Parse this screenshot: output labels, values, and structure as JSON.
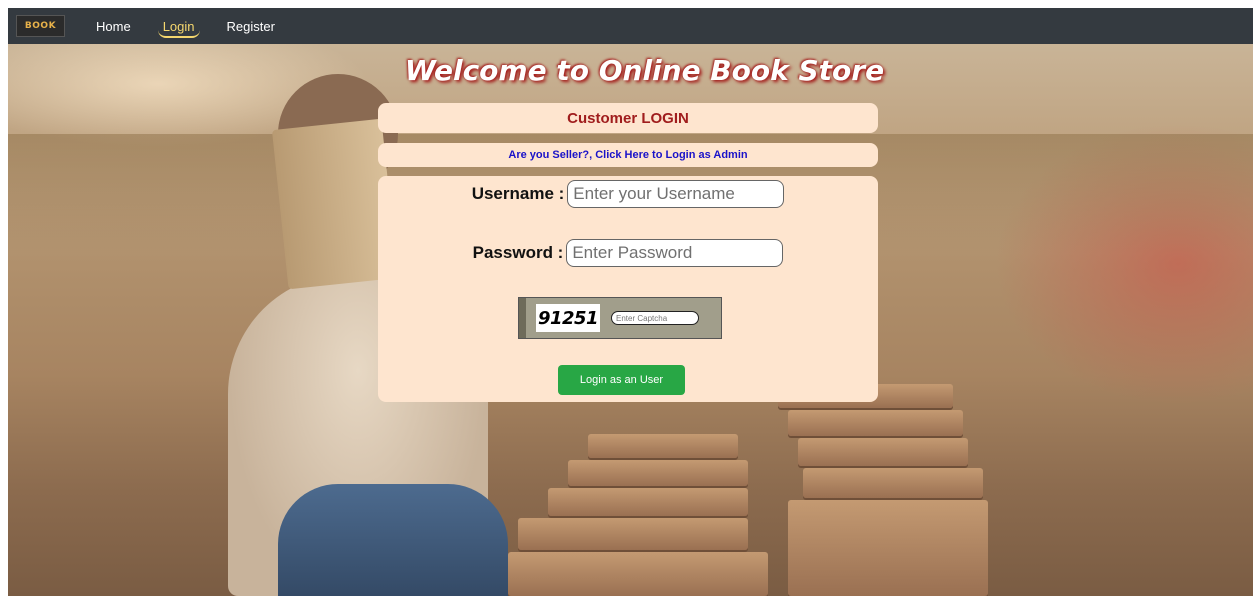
{
  "nav": {
    "logo_text": "BOOK",
    "items": [
      {
        "label": "Home"
      },
      {
        "label": "Login"
      },
      {
        "label": "Register"
      }
    ],
    "active": "Login"
  },
  "page": {
    "heading": "Welcome to Online Book Store",
    "subtitle": "Customer LOGIN",
    "seller_link": "Are you Seller?, Click Here to Login as Admin"
  },
  "form": {
    "username_label": "Username :",
    "username_placeholder": "Enter your Username",
    "username_value": "",
    "password_label": "Password :",
    "password_placeholder": "Enter Password",
    "password_value": "",
    "captcha_code": "91251",
    "captcha_placeholder": "Enter Captcha",
    "submit_label": "Login as an User"
  },
  "colors": {
    "navbar": "#343a40",
    "active_link": "#f5d76e",
    "panel": "#fee5cf",
    "title_red": "#a01d1d",
    "link_blue": "#1a12c9",
    "button_green": "#28a745"
  }
}
